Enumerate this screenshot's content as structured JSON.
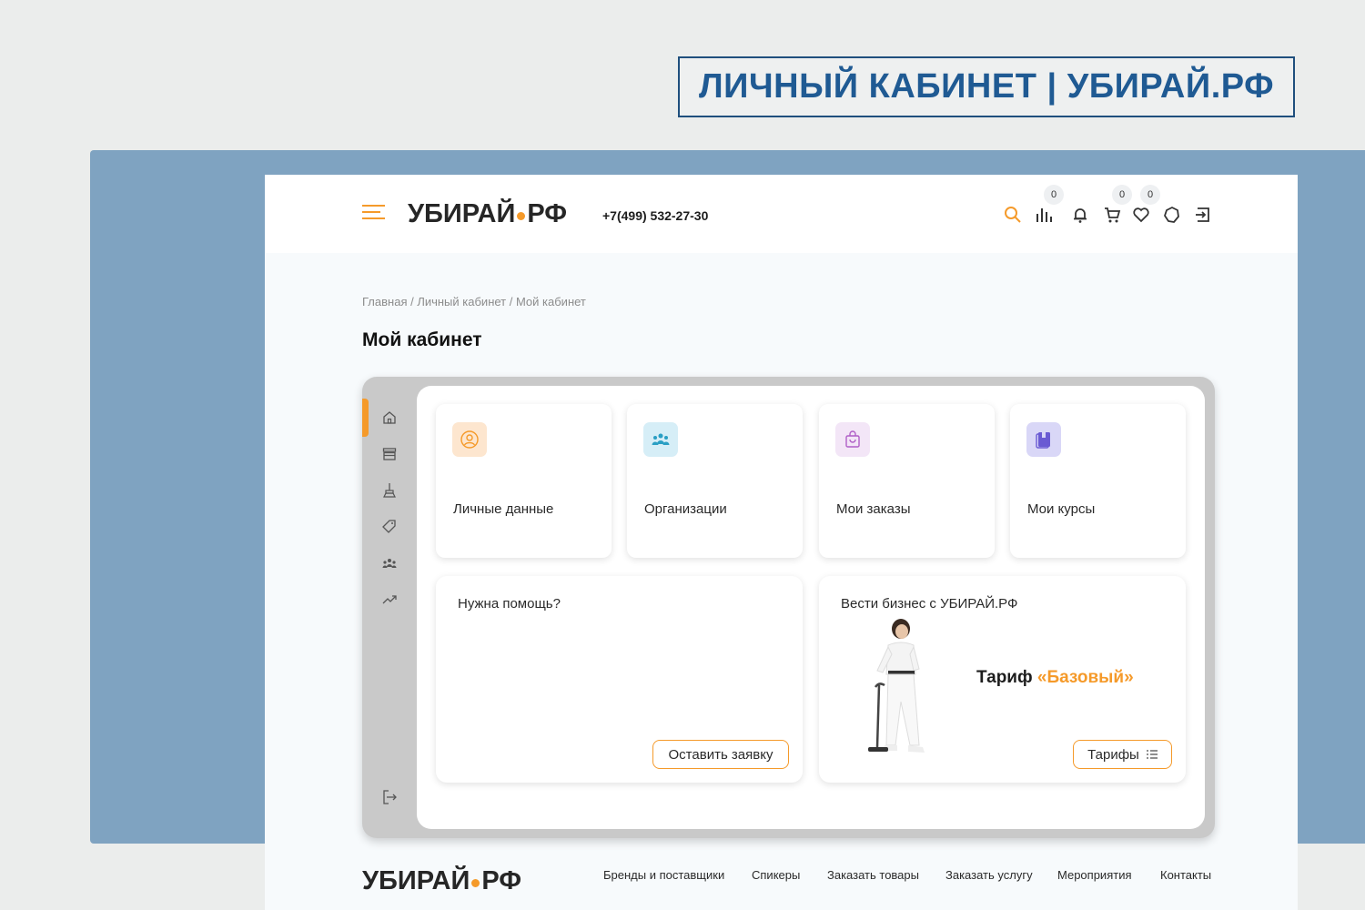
{
  "banner": {
    "title": "ЛИЧНЫЙ КАБИНЕТ | УБИРАЙ.РФ"
  },
  "header": {
    "logo_left": "УБИРАЙ",
    "logo_right": "РФ",
    "phone": "+7(499) 532-27-30",
    "badges": {
      "stats": "0",
      "cart": "0",
      "favorites": "0"
    }
  },
  "breadcrumb": "Главная / Личный кабинет / Мой кабинет",
  "page_title": "Мой кабинет",
  "tiles": [
    {
      "label": "Личные данные",
      "icon": "user-icon",
      "bg": "#fde6cf"
    },
    {
      "label": "Организации",
      "icon": "people-icon",
      "bg": "#d6eef7"
    },
    {
      "label": "Мои заказы",
      "icon": "bag-icon",
      "bg": "#f3e6f7"
    },
    {
      "label": "Мои курсы",
      "icon": "book-icon",
      "bg": "#d9d7f7"
    }
  ],
  "help_card": {
    "title": "Нужна помощь?",
    "button": "Оставить заявку"
  },
  "business_card": {
    "title": "Вести бизнес с УБИРАЙ.РФ",
    "tariff_prefix": "Тариф ",
    "tariff_name": "«Базовый»",
    "button": "Тарифы"
  },
  "footer": {
    "logo_left": "УБИРАЙ",
    "logo_right": "РФ",
    "nav": [
      "Бренды и поставщики",
      "Спикеры",
      "Заказать товары",
      "Заказать услугу",
      "Мероприятия",
      "Контакты"
    ]
  },
  "colors": {
    "accent": "#f59a2a",
    "banner_text": "#1f5a93",
    "panel": "#7fa3c1"
  }
}
